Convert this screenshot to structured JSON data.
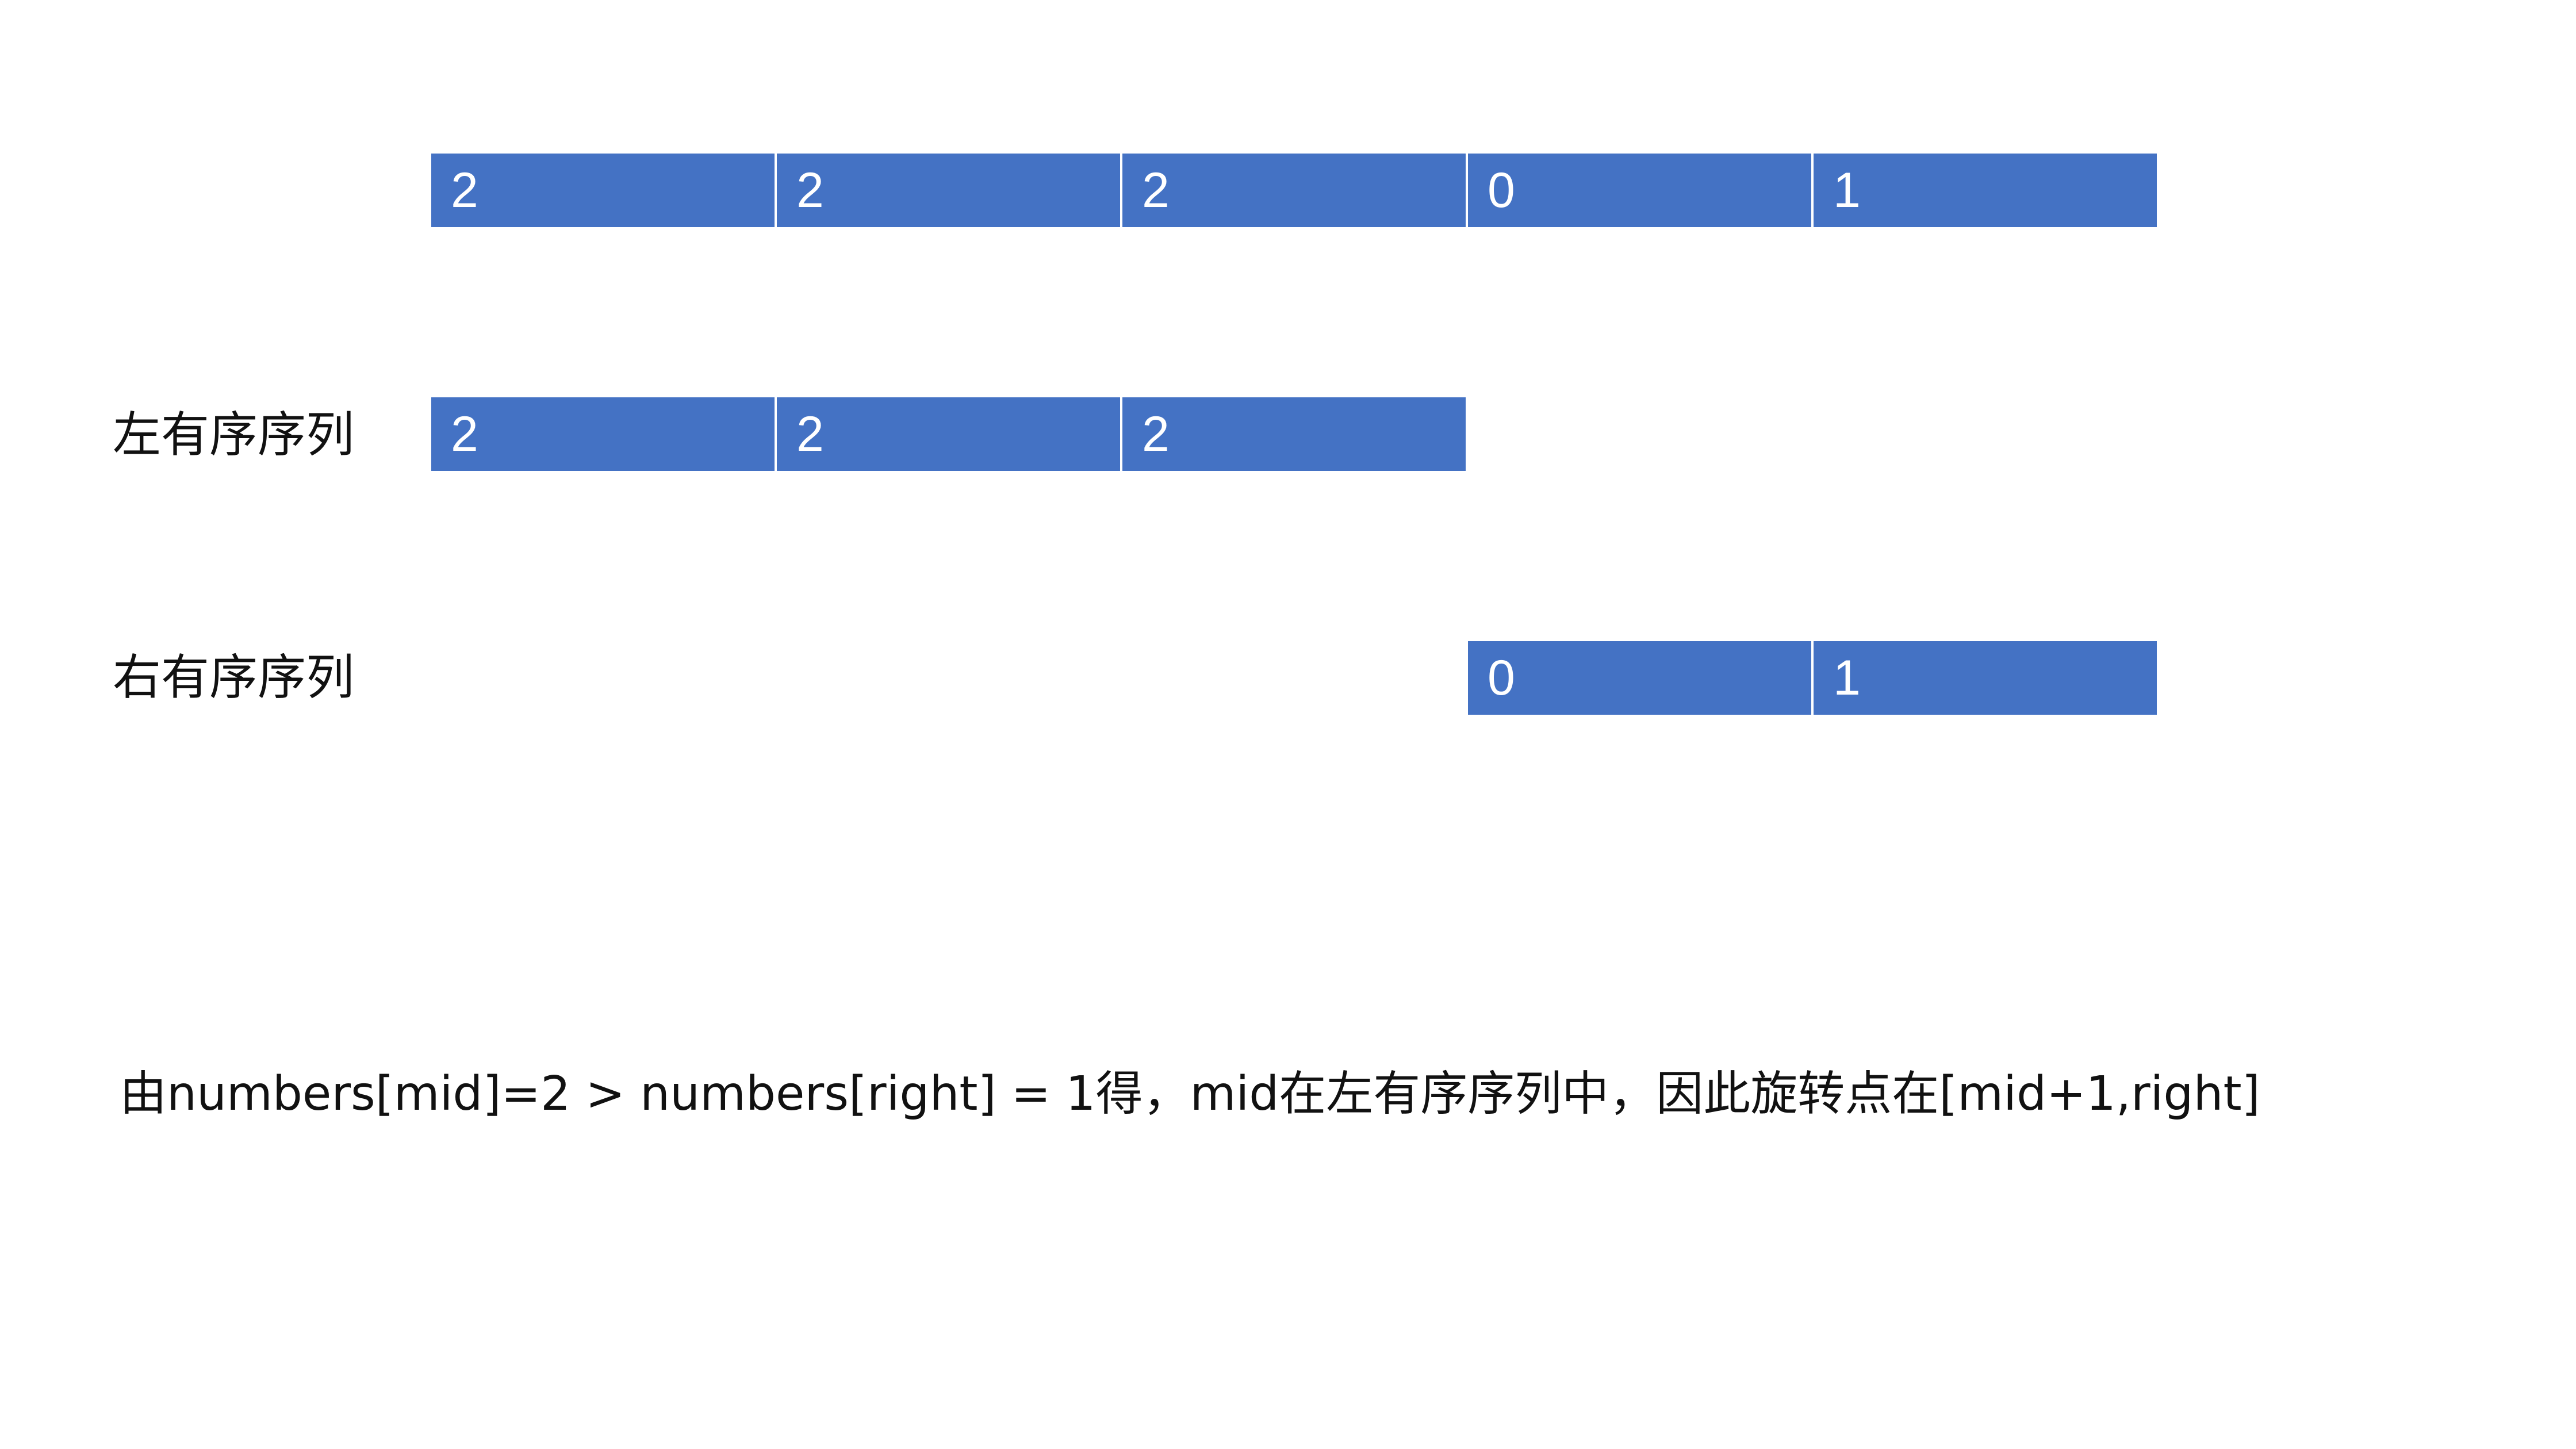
{
  "array": {
    "cells": [
      "2",
      "2",
      "2",
      "0",
      "1"
    ]
  },
  "left_sorted": {
    "label": "左有序序列",
    "cells": [
      "2",
      "2",
      "2"
    ]
  },
  "right_sorted": {
    "label": "右有序序列",
    "cells": [
      "0",
      "1"
    ]
  },
  "caption": "由numbers[mid]=2 > numbers[right] = 1得，mid在左有序序列中，因此旋转点在[mid+1,right]",
  "colors": {
    "cell_fill": "#4472C4",
    "cell_text": "#FFFFFF",
    "text": "#111111"
  }
}
